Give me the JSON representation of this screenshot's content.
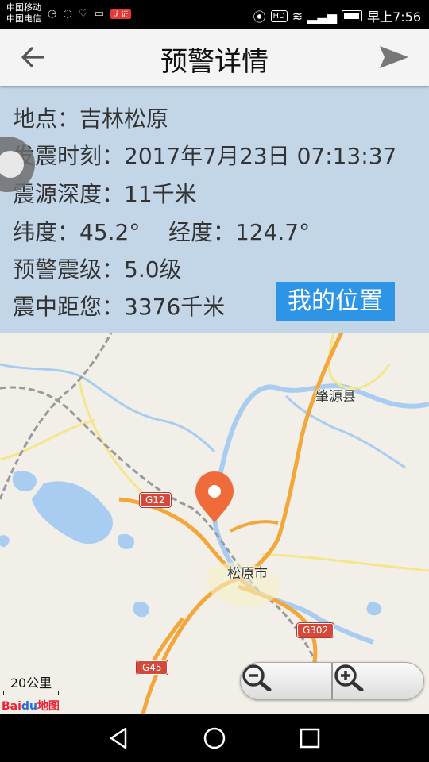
{
  "status_bar": {
    "carrier_1": "中国移动",
    "carrier_2": "中国电信",
    "net_badge": "认证",
    "hd": "HD",
    "time": "早上7:56"
  },
  "app_bar": {
    "title": "预警详情",
    "back_icon": "arrow-back-icon",
    "share_icon": "send-icon"
  },
  "info": {
    "location": "地点：吉林松原",
    "time": "发震时刻：2017年7月23日 07:13:37",
    "depth": "震源深度：11千米",
    "coords": "纬度：45.2°    经度：124.7°",
    "magnitude": "预警震级：5.0级",
    "distance": "震中距您：3376千米",
    "my_location_button": "我的位置"
  },
  "map": {
    "labels": {
      "zhaoyuan": "肇源县",
      "songyuan": "松原市"
    },
    "road_signs": {
      "g12": "G12",
      "g302": "G302",
      "g45": "G45"
    },
    "scale": "20公里",
    "logo_bai": "Bai",
    "logo_du": "du",
    "logo_map": "地图",
    "marker_color": "#ef6c3a"
  },
  "colors": {
    "info_bg": "#c3d6e8",
    "button_bg": "#2e94e6"
  }
}
